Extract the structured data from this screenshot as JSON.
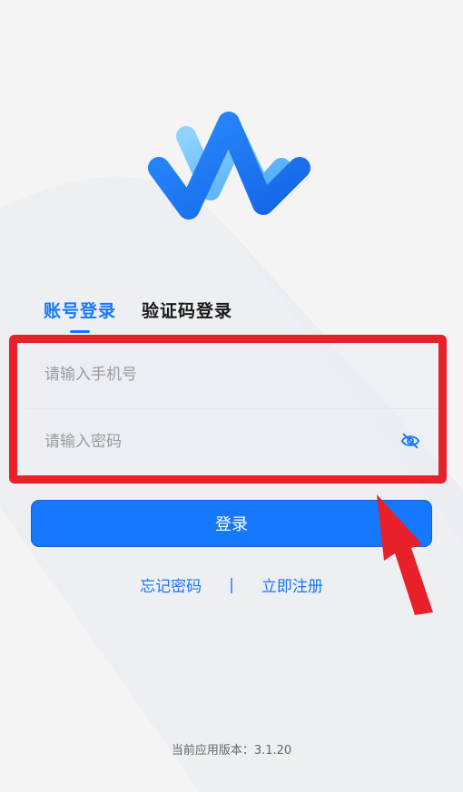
{
  "tabs": {
    "account_login": "账号登录",
    "code_login": "验证码登录"
  },
  "form": {
    "phone_placeholder": "请输入手机号",
    "password_placeholder": "请输入密码",
    "password_toggle_icon": "eye-off-icon"
  },
  "login_button": "登录",
  "links": {
    "forgot_password": "忘记密码",
    "separator": "|",
    "register": "立即注册"
  },
  "version_text": "当前应用版本：3.1.20",
  "colors": {
    "primary": "#1677ff",
    "highlight": "#e8202a",
    "background": "#f4f4f5"
  }
}
